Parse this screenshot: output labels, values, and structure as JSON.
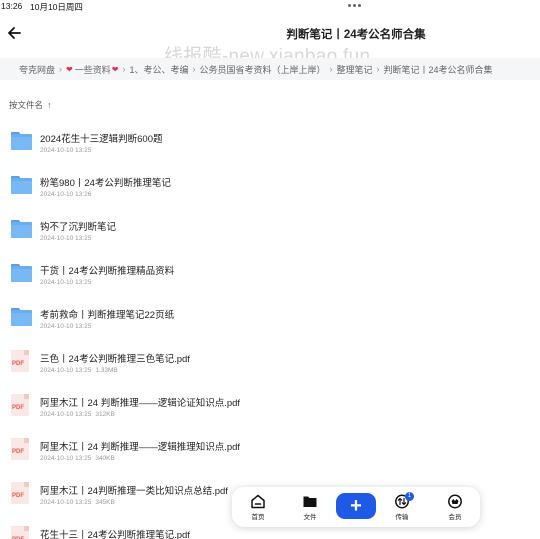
{
  "status_bar": {
    "time": "13:26",
    "date": "10月10日周四"
  },
  "nav": {
    "title": "判断笔记丨24考公名师合集"
  },
  "watermark": "线报酷-new.xianbao.fun",
  "breadcrumb": {
    "items": [
      "夸克网盘",
      "一些资料",
      "1、考公、考编",
      "公务员国省考资料（上岸上岸）",
      "整理笔记",
      "判断笔记丨24考公名师合集"
    ],
    "separator": "›"
  },
  "sort": {
    "label": "按文件名",
    "arrow": "↑"
  },
  "files": [
    {
      "type": "folder",
      "name": "2024花生十三逻辑判断600题",
      "date": "2024-10-10 13:25",
      "size": ""
    },
    {
      "type": "folder",
      "name": "粉笔980丨24考公判断推理笔记",
      "date": "2024-10-10 13:26",
      "size": ""
    },
    {
      "type": "folder",
      "name": "钩不了沉判断笔记",
      "date": "2024-10-10 13:25",
      "size": ""
    },
    {
      "type": "folder",
      "name": "干货丨24考公判断推理精品资料",
      "date": "2024-10-10 13:25",
      "size": ""
    },
    {
      "type": "folder",
      "name": "考前救命丨判断推理笔记22页纸",
      "date": "2024-10-10 13:25",
      "size": ""
    },
    {
      "type": "pdf",
      "name": "三色丨24考公判断推理三色笔记.pdf",
      "date": "2024-10-10 13:25",
      "size": "1.33MB"
    },
    {
      "type": "pdf",
      "name": "阿里木江丨24 判断推理——逻辑论证知识点.pdf",
      "date": "2024-10-10 13:25",
      "size": "312KB"
    },
    {
      "type": "pdf",
      "name": "阿里木江丨24 判断推理——逻辑推理知识点.pdf",
      "date": "2024-10-10 13:25",
      "size": "340KB"
    },
    {
      "type": "pdf",
      "name": "阿里木江丨24判断推理一类比知识点总结.pdf",
      "date": "2024-10-10 13:25",
      "size": "345KB"
    },
    {
      "type": "pdf",
      "name": "花生十三丨24考公判断推理笔记.pdf",
      "date": "",
      "size": ""
    }
  ],
  "pdf_icon_label": "PDF",
  "bottom_bar": {
    "home": "首页",
    "files": "文件",
    "add": "+",
    "transfer": "传输",
    "transfer_badge": "1",
    "member": "会员"
  },
  "colors": {
    "accent": "#1f5ae6",
    "heart": "#e0324b",
    "folder": "#6aaef0",
    "pdf": "#e35b4f"
  }
}
